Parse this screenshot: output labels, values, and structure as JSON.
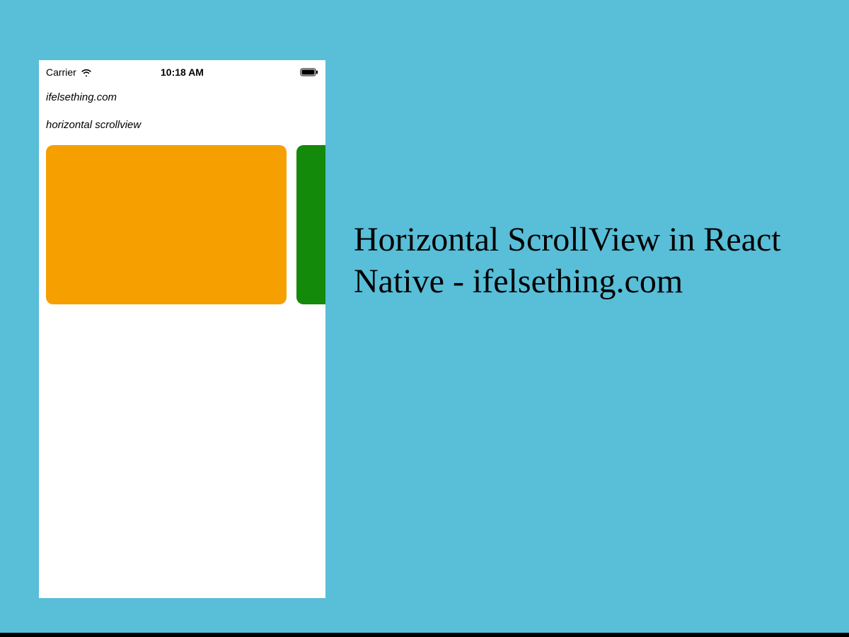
{
  "statusBar": {
    "carrier": "Carrier",
    "time": "10:18 AM"
  },
  "phone": {
    "site": "ifelsething.com",
    "subtitle": "horizontal scrollview",
    "cards": [
      {
        "color": "#f5a000"
      },
      {
        "color": "#148a0a"
      }
    ]
  },
  "headline": "Horizontal ScrollView in React Native - ifelsething.com",
  "colors": {
    "background": "#59bed7",
    "orange": "#f5a000",
    "green": "#148a0a"
  }
}
